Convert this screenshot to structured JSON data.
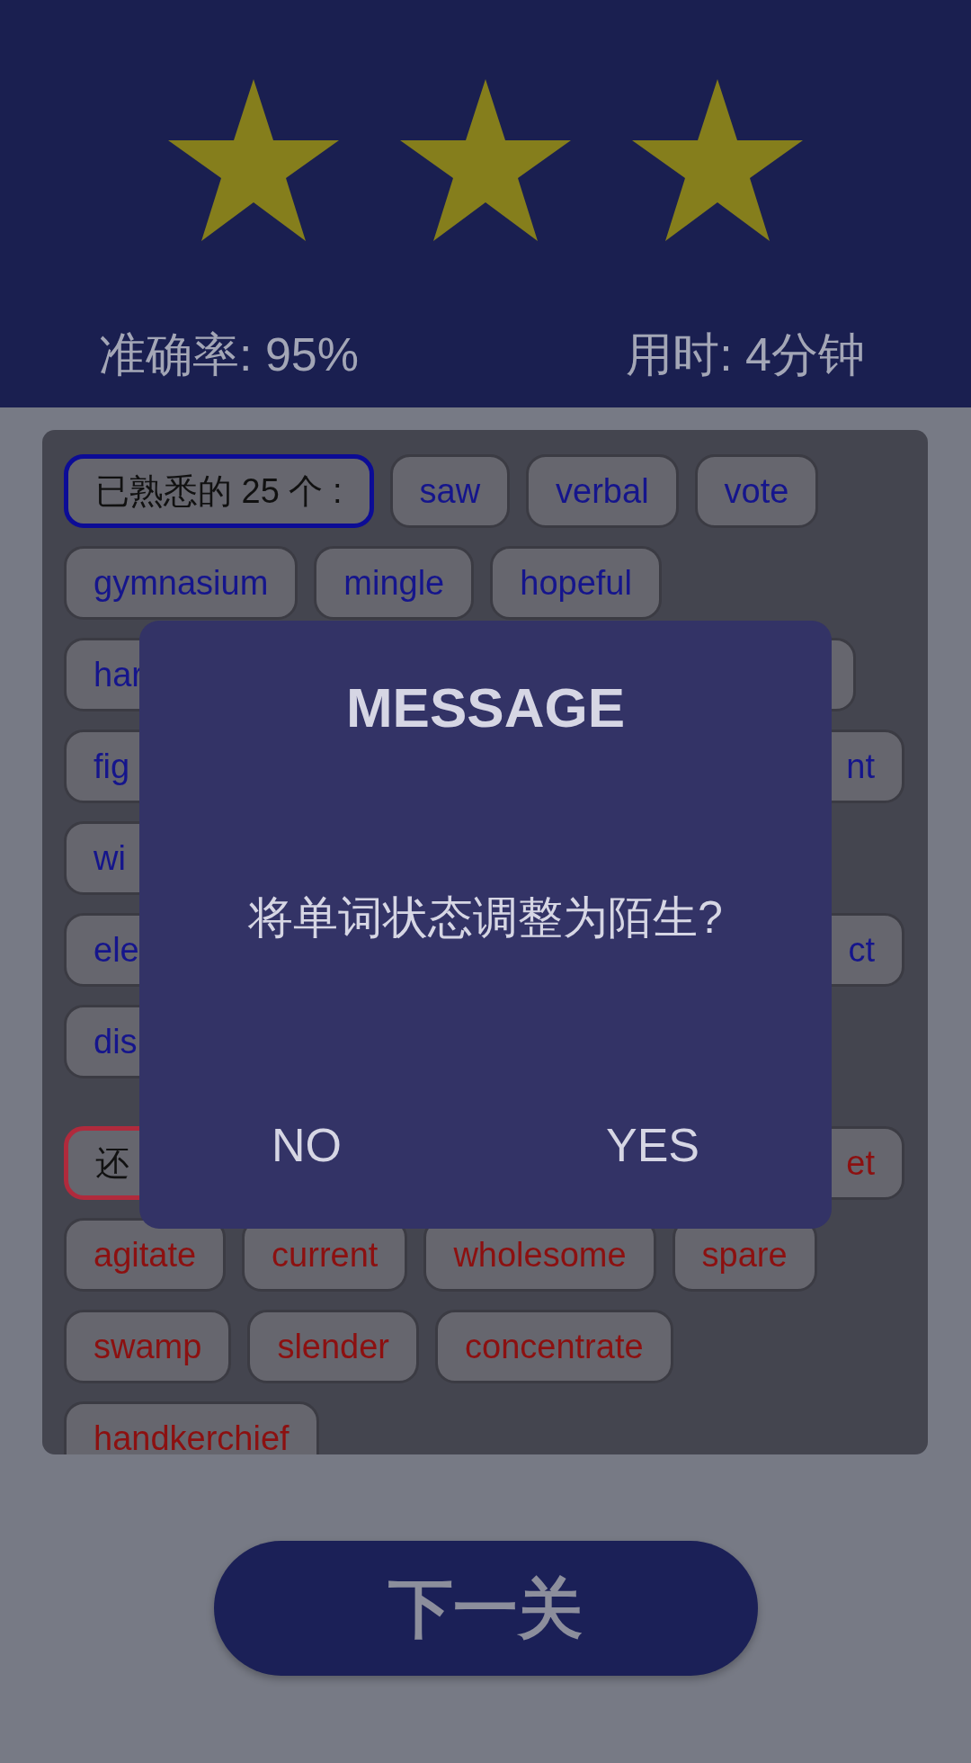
{
  "header": {
    "stars": 3,
    "accuracy": "准确率: 95%",
    "time": "用时: 4分钟"
  },
  "sections": [
    {
      "kind": "familiar",
      "rows": [
        [
          {
            "kind": "label",
            "text": "已熟悉的 25 个 :",
            "color": "#0c0c96"
          },
          {
            "kind": "word",
            "text": "saw"
          },
          {
            "kind": "word",
            "text": "verbal"
          },
          {
            "kind": "word",
            "text": "vote"
          }
        ],
        [
          {
            "kind": "word",
            "text": "gymnasium"
          },
          {
            "kind": "word",
            "text": "mingle"
          },
          {
            "kind": "word",
            "text": "hopeful"
          }
        ],
        [
          {
            "kind": "cut-left",
            "text": "har"
          },
          {
            "kind": "edge"
          }
        ],
        [
          {
            "kind": "cut-left",
            "text": "fig"
          },
          {
            "kind": "cut-right",
            "text": "nt"
          }
        ],
        [
          {
            "kind": "cut-left",
            "text": "wi"
          }
        ],
        [
          {
            "kind": "cut-left",
            "text": "ele"
          },
          {
            "kind": "cut-right",
            "text": "ct"
          }
        ],
        [
          {
            "kind": "cut-left",
            "text": "dis"
          }
        ]
      ]
    },
    {
      "kind": "unfamiliar",
      "rows": [
        [
          {
            "kind": "cut-label",
            "text": "还",
            "color": "#b02a3c"
          },
          {
            "kind": "cut-right",
            "text": "et"
          }
        ],
        [
          {
            "kind": "word",
            "text": "agitate"
          },
          {
            "kind": "word",
            "text": "current"
          },
          {
            "kind": "word",
            "text": "wholesome"
          },
          {
            "kind": "word",
            "text": "spare"
          }
        ],
        [
          {
            "kind": "word",
            "text": "swamp"
          },
          {
            "kind": "word",
            "text": "slender"
          },
          {
            "kind": "word",
            "text": "concentrate"
          }
        ],
        [
          {
            "kind": "word",
            "text": "handkerchief"
          }
        ]
      ]
    }
  ],
  "dialog": {
    "title": "MESSAGE",
    "message": "将单词状态调整为陌生?",
    "buttons": [
      "NO",
      "YES"
    ]
  },
  "next_button": "下一关"
}
